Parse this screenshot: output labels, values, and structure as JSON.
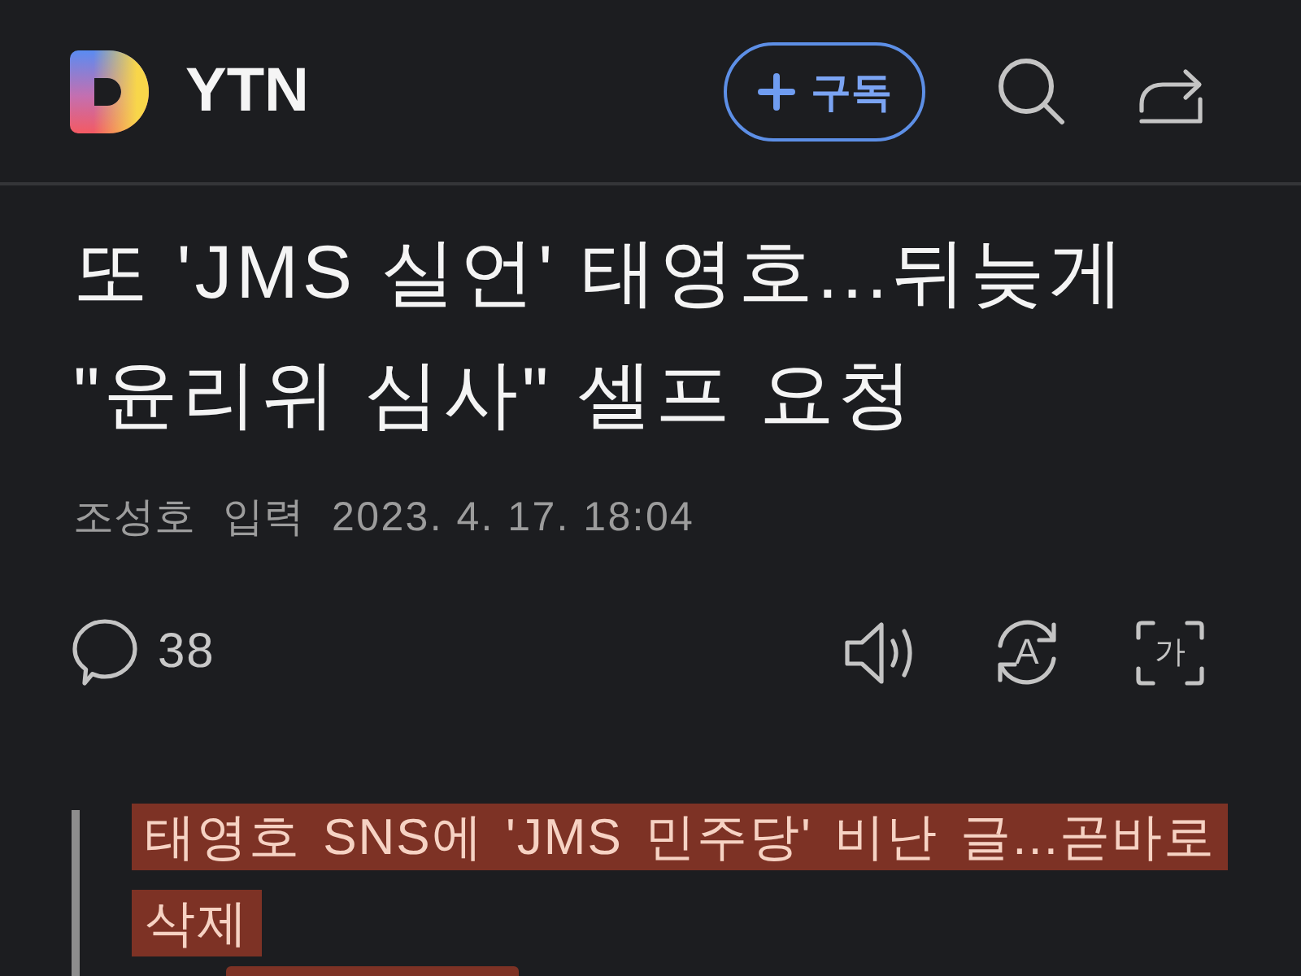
{
  "header": {
    "channel": "YTN",
    "subscribe_button": {
      "label": "구독"
    }
  },
  "article": {
    "title": "또 'JMS 실언' 태영호...뒤늦게 \"윤리위 심사\" 셀프 요청",
    "byline": {
      "author": "조성호",
      "date_label": "입력",
      "date": "2023. 4. 17. 18:04"
    },
    "comment_count": "38",
    "tools": [
      {
        "kind": "listen"
      },
      {
        "kind": "translate",
        "glyph": "A"
      },
      {
        "kind": "text_size",
        "glyph": "가"
      }
    ],
    "quote": {
      "text": "태영호 SNS에 'JMS 민주당' 비난 글...곧바로 삭제",
      "highlighted": true
    }
  }
}
